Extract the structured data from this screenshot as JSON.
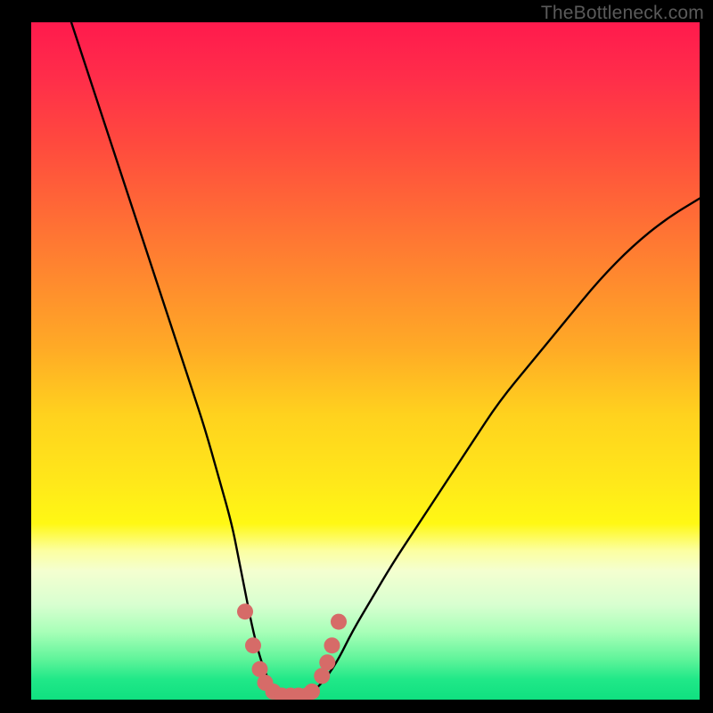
{
  "watermark": "TheBottleneck.com",
  "chart_data": {
    "type": "line",
    "title": "",
    "xlabel": "",
    "ylabel": "",
    "xlim": [
      0,
      100
    ],
    "ylim": [
      0,
      100
    ],
    "series": [
      {
        "name": "bottleneck-curve",
        "x": [
          6,
          8,
          10,
          12,
          14,
          16,
          18,
          20,
          22,
          24,
          26,
          28,
          30,
          31,
          32,
          33,
          34,
          35,
          36,
          37,
          38,
          39,
          40,
          41,
          42,
          44,
          46,
          48,
          51,
          54,
          58,
          62,
          66,
          70,
          75,
          80,
          85,
          90,
          95,
          100
        ],
        "y": [
          100,
          94,
          88,
          82,
          76,
          70,
          64,
          58,
          52,
          46,
          40,
          33,
          26,
          21,
          16,
          11,
          7,
          4,
          2,
          1,
          0.5,
          0.5,
          0.5,
          0.5,
          1,
          3,
          6,
          10,
          15,
          20,
          26,
          32,
          38,
          44,
          50,
          56,
          62,
          67,
          71,
          74
        ]
      },
      {
        "name": "marker-dots",
        "x": [
          32.0,
          33.2,
          34.2,
          35.0,
          36.2,
          37.5,
          38.8,
          40.0,
          41.2,
          42.0,
          43.5,
          44.3,
          45.0,
          46.0
        ],
        "y": [
          13.0,
          8.0,
          4.5,
          2.5,
          1.2,
          0.6,
          0.6,
          0.6,
          0.6,
          1.2,
          3.5,
          5.5,
          8.0,
          11.5
        ]
      }
    ],
    "background_gradient": {
      "top": "#ff1a4d",
      "mid": "#ffe81a",
      "bottom": "#10e080"
    },
    "marker_color": "#d66b68",
    "curve_color": "#000000"
  }
}
